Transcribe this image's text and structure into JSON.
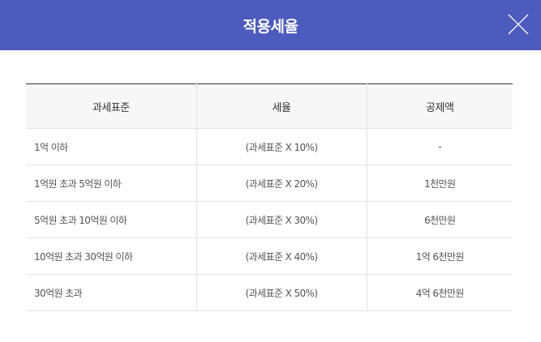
{
  "modal": {
    "title": "적용세율",
    "close_icon": "close-icon",
    "header_color": "#4c5bbd"
  },
  "table": {
    "headers": [
      "과세표준",
      "세율",
      "공제액"
    ],
    "rows": [
      {
        "base": "1억 이하",
        "rate": "(과세표준 X 10%)",
        "deduction": "-"
      },
      {
        "base": "1억원 초과 5억원 이하",
        "rate": "(과세표준 X 20%)",
        "deduction": "1천만원"
      },
      {
        "base": "5억원 초과 10억원 이하",
        "rate": "(과세표준 X 30%)",
        "deduction": "6천만원"
      },
      {
        "base": "10억원 초과 30억원 이하",
        "rate": "(과세표준 X 40%)",
        "deduction": "1억 6천만원"
      },
      {
        "base": "30억원 초과",
        "rate": "(과세표준 X 50%)",
        "deduction": "4억 6천만원"
      }
    ]
  }
}
